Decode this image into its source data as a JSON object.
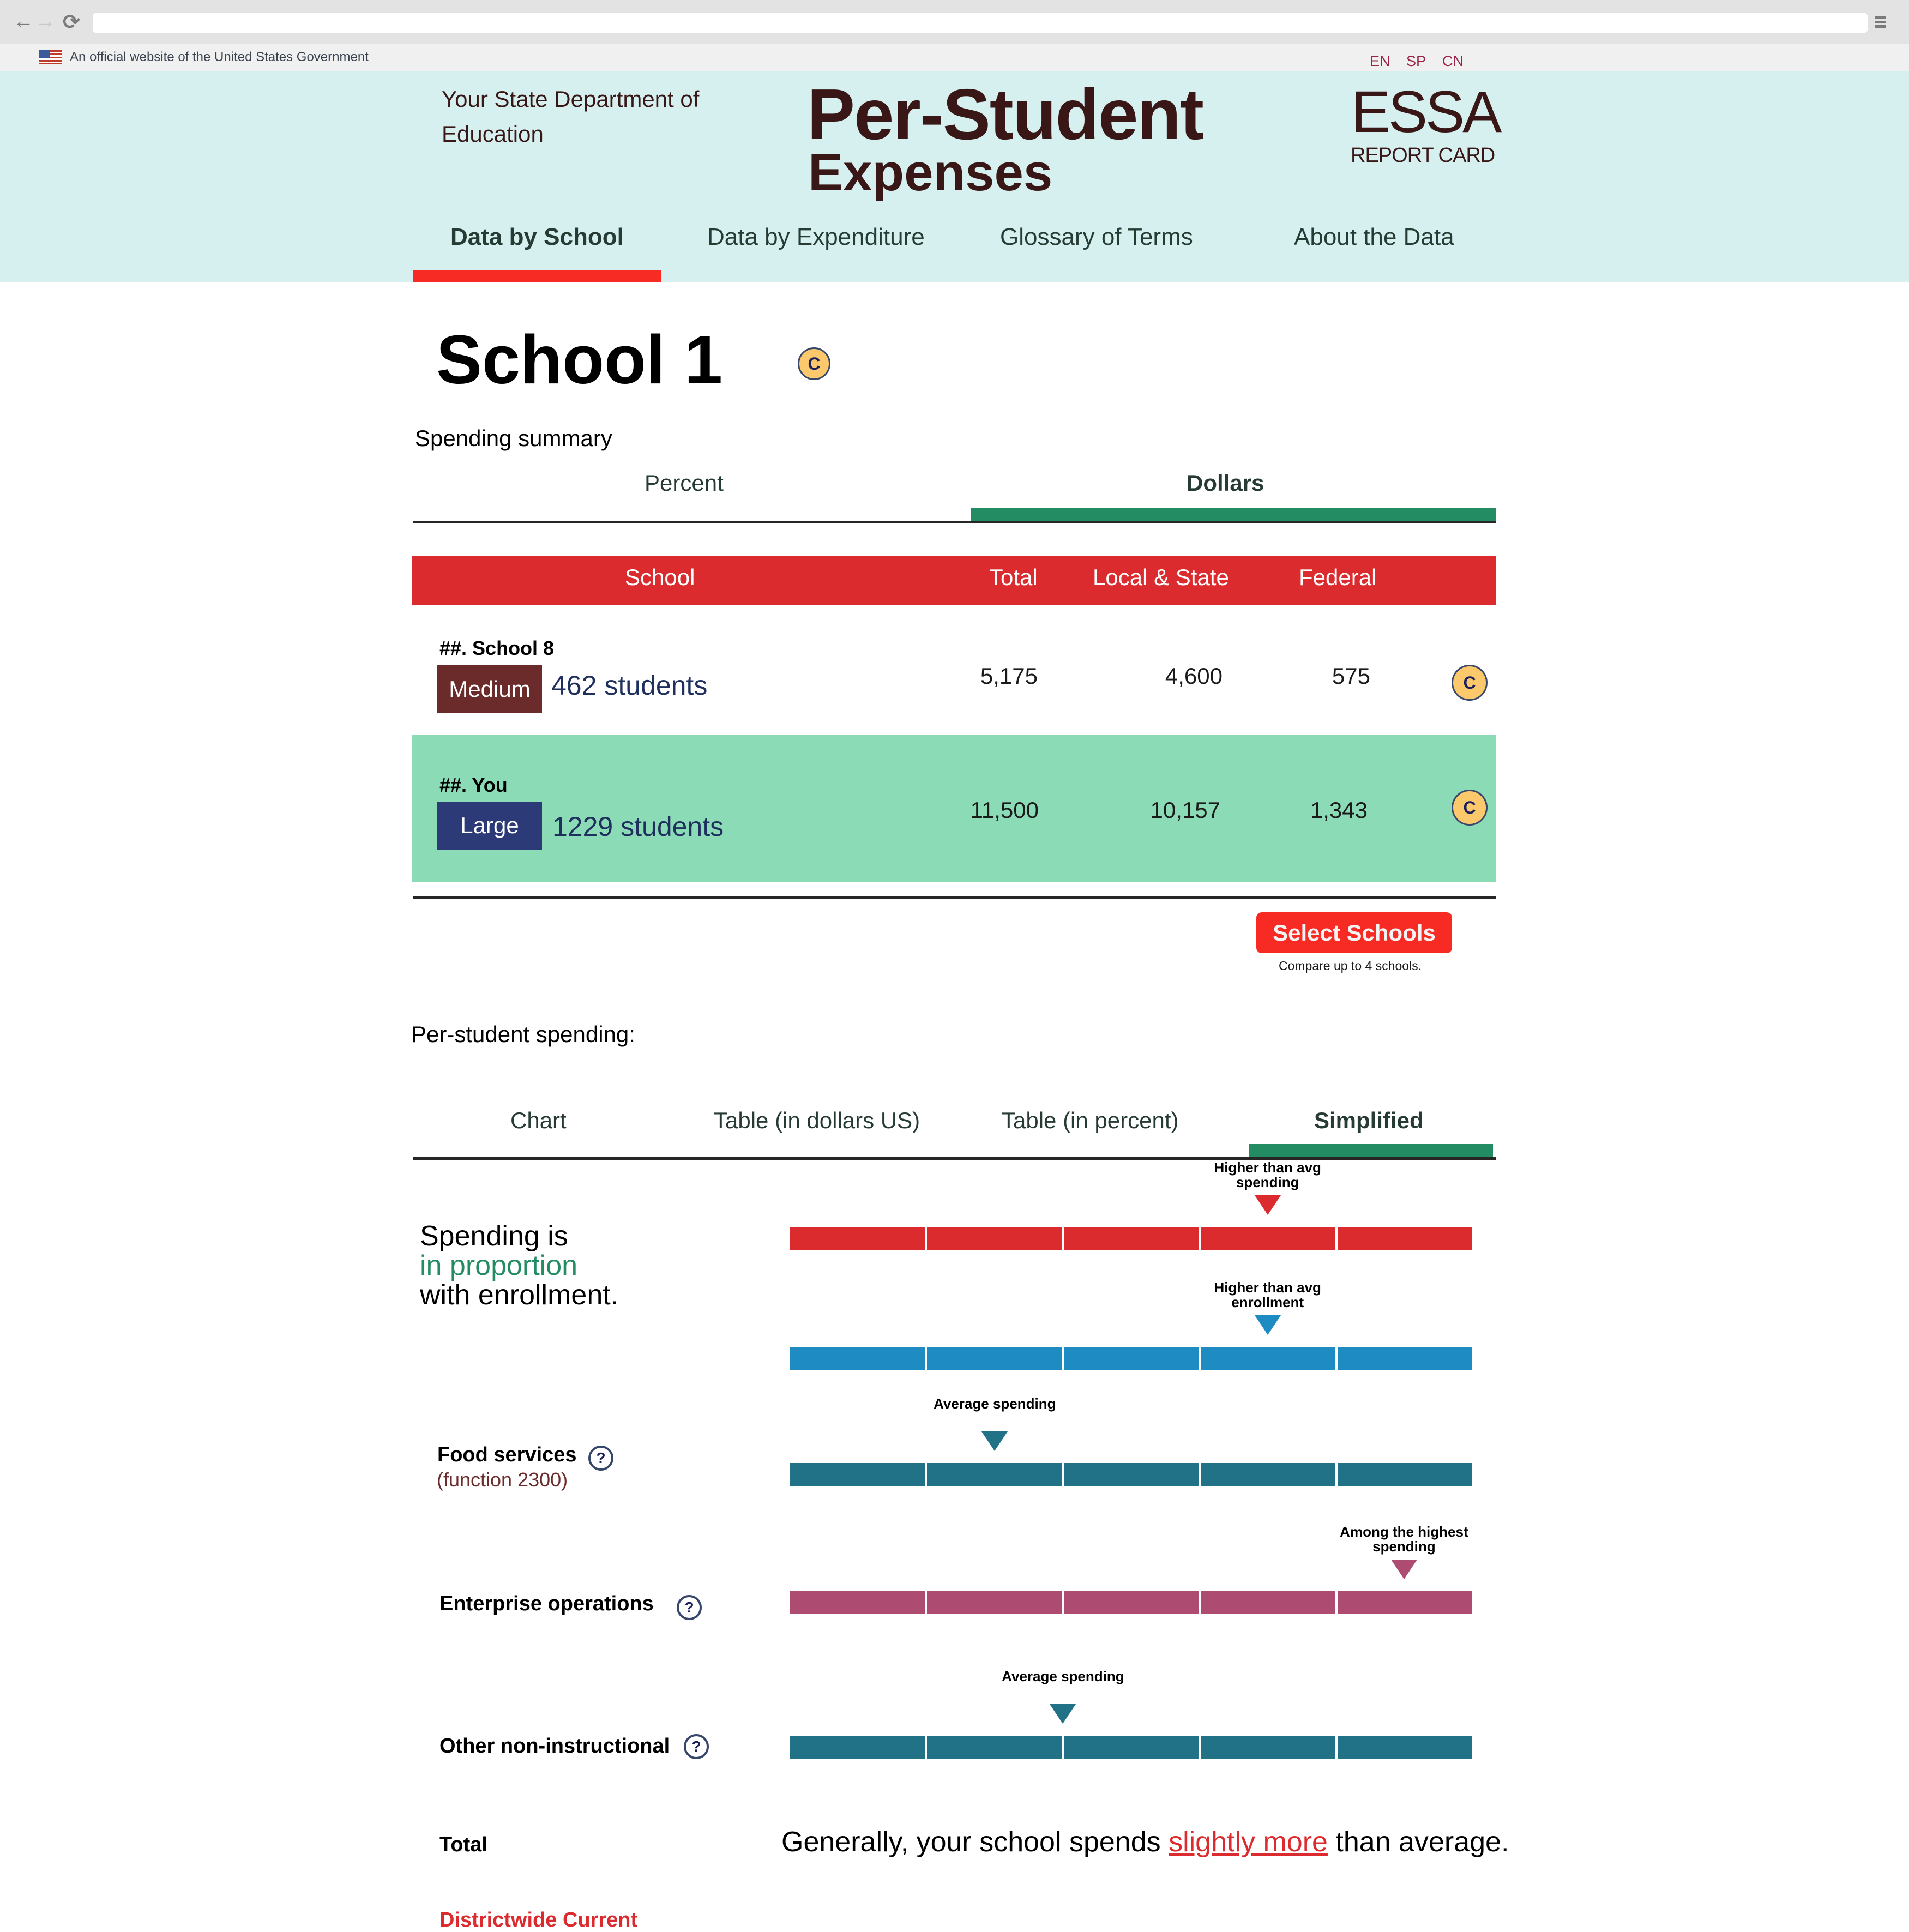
{
  "browser": {
    "back_icon": "←",
    "forward_icon": "→",
    "reload_icon": "⟳"
  },
  "gov_banner": {
    "text": "An official website of the United States Government"
  },
  "languages": [
    "EN",
    "SP",
    "CN"
  ],
  "header": {
    "department_line1": "Your State Department of",
    "department_line2": "Education",
    "title_line1": "Per-Student",
    "title_line2": "Expenses",
    "logo_main": "ESSA",
    "logo_sub": "REPORT CARD"
  },
  "main_nav": [
    {
      "label": "Data by School",
      "active": true
    },
    {
      "label": "Data by Expenditure",
      "active": false
    },
    {
      "label": "Glossary of Terms",
      "active": false
    },
    {
      "label": "About the Data",
      "active": false
    }
  ],
  "school": {
    "name": "School 1",
    "badge": "C"
  },
  "spending_summary": {
    "label": "Spending summary",
    "tabs": [
      {
        "label": "Percent",
        "active": false
      },
      {
        "label": "Dollars",
        "active": true
      }
    ],
    "columns": [
      "School",
      "Total",
      "Local & State",
      "Federal"
    ],
    "rows": [
      {
        "name": "##. School 8",
        "size": "Medium",
        "size_color": "#6b2b2b",
        "students": "462 students",
        "total": "5,175",
        "local_state": "4,600",
        "federal": "575",
        "badge": "C",
        "highlighted": false
      },
      {
        "name": "##. You",
        "size": "Large",
        "size_color": "#2c3a78",
        "students": "1229 students",
        "total": "11,500",
        "local_state": "10,157",
        "federal": "1,343",
        "badge": "C",
        "highlighted": true
      }
    ],
    "select_button": "Select Schools",
    "select_hint": "Compare up to 4 schools."
  },
  "per_student": {
    "label": "Per-student spending:",
    "tabs": [
      {
        "label": "Chart",
        "active": false
      },
      {
        "label": "Table (in dollars US)",
        "active": false
      },
      {
        "label": "Table (in percent)",
        "active": false
      },
      {
        "label": "Simplified",
        "active": true
      }
    ],
    "lead": {
      "line1": "Spending is",
      "line2": "in proportion",
      "line3": "with enrollment."
    },
    "scales": [
      {
        "id": "spending",
        "label": "",
        "marker_text": "Higher than avg spending",
        "segment": 4,
        "segments": 5,
        "color": "#dc2b2e"
      },
      {
        "id": "enrollment",
        "label": "",
        "marker_text": "Higher than avg enrollment",
        "segment": 4,
        "segments": 5,
        "color": "#1e8bc3"
      },
      {
        "id": "food",
        "label": "Food services",
        "sublabel": "(function 2300)",
        "marker_text": "Average spending",
        "segment": 2.0,
        "segments": 5,
        "color": "#227287"
      },
      {
        "id": "enterprise",
        "label": "Enterprise operations",
        "marker_text": "Among the highest spending",
        "segment": 5,
        "segments": 5,
        "color": "#ad4c70"
      },
      {
        "id": "other",
        "label": "Other non-instructional",
        "marker_text": "Average spending",
        "segment": 2.5,
        "segments": 5,
        "color": "#227287"
      }
    ],
    "help_icon": "?",
    "total_label": "Total",
    "total_sentence": {
      "before": "Generally, your school spends ",
      "link": "slightly more",
      "after": " than average."
    },
    "district_label": "Districtwide Current"
  }
}
